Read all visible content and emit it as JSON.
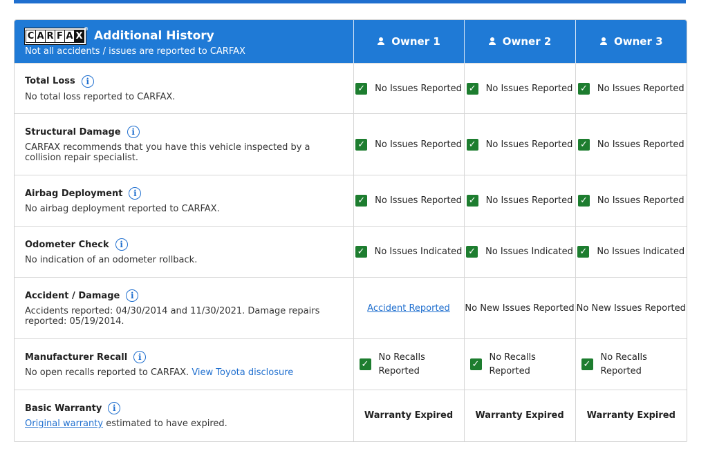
{
  "header": {
    "logo_letters": [
      "C",
      "A",
      "R",
      "F",
      "A",
      "X"
    ],
    "logo_tm": "®",
    "title": "Additional History",
    "subtitle": "Not all accidents / issues are reported to CARFAX",
    "owners": [
      "Owner 1",
      "Owner 2",
      "Owner 3"
    ]
  },
  "rows": [
    {
      "label": "Total Loss",
      "description": "No total loss reported to CARFAX.",
      "owners": [
        "No Issues Reported",
        "No Issues Reported",
        "No Issues Reported"
      ]
    },
    {
      "label": "Structural Damage",
      "description": "CARFAX recommends that you have this vehicle inspected by a collision repair specialist.",
      "owners": [
        "No Issues Reported",
        "No Issues Reported",
        "No Issues Reported"
      ]
    },
    {
      "label": "Airbag Deployment",
      "description": "No airbag deployment reported to CARFAX.",
      "owners": [
        "No Issues Reported",
        "No Issues Reported",
        "No Issues Reported"
      ]
    },
    {
      "label": "Odometer Check",
      "description": "No indication of an odometer rollback.",
      "owners": [
        "No Issues Indicated",
        "No Issues Indicated",
        "No Issues Indicated"
      ]
    },
    {
      "label": "Accident / Damage",
      "description": "Accidents reported: 04/30/2014 and 11/30/2021. Damage repairs reported: 05/19/2014.",
      "owners": [
        "Accident Reported",
        "No New Issues Reported",
        "No New Issues Reported"
      ]
    },
    {
      "label": "Manufacturer Recall",
      "description": "No open recalls reported to CARFAX.",
      "link": "View Toyota disclosure",
      "owners": [
        "No Recalls Reported",
        "No Recalls Reported",
        "No Recalls Reported"
      ]
    },
    {
      "label": "Basic Warranty",
      "link": "Original warranty",
      "description": "estimated to have expired.",
      "owners": [
        "Warranty Expired",
        "Warranty Expired",
        "Warranty Expired"
      ]
    }
  ],
  "icons": {
    "info": "info-circle-icon",
    "check": "checkbox-checked-icon",
    "person": "person-icon"
  },
  "colors": {
    "header_blue": "#1f7ad6",
    "check_green": "#1d7d2f",
    "link_blue": "#1f6fcf"
  }
}
